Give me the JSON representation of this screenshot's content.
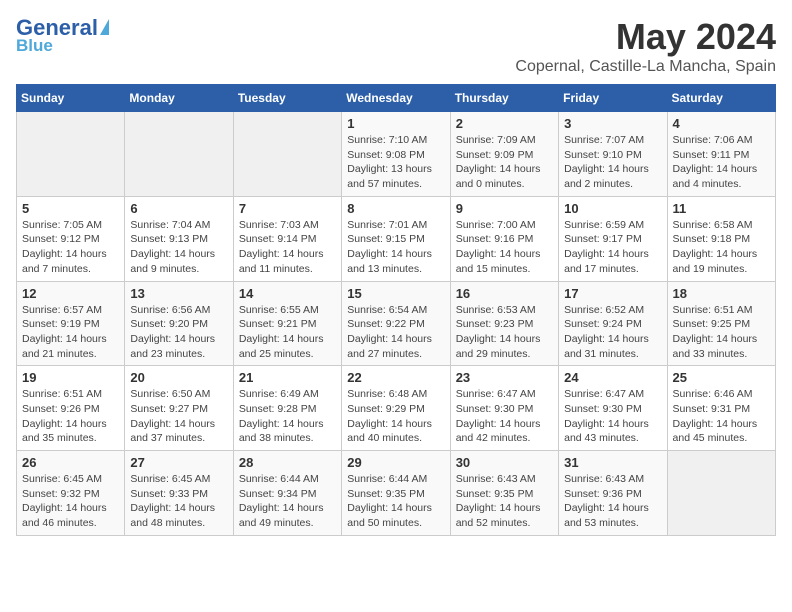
{
  "header": {
    "logo_general": "General",
    "logo_blue": "Blue",
    "title": "May 2024",
    "subtitle": "Copernal, Castille-La Mancha, Spain"
  },
  "days_of_week": [
    "Sunday",
    "Monday",
    "Tuesday",
    "Wednesday",
    "Thursday",
    "Friday",
    "Saturday"
  ],
  "weeks": [
    [
      {
        "day": "",
        "info": ""
      },
      {
        "day": "",
        "info": ""
      },
      {
        "day": "",
        "info": ""
      },
      {
        "day": "1",
        "info": "Sunrise: 7:10 AM\nSunset: 9:08 PM\nDaylight: 13 hours and 57 minutes."
      },
      {
        "day": "2",
        "info": "Sunrise: 7:09 AM\nSunset: 9:09 PM\nDaylight: 14 hours and 0 minutes."
      },
      {
        "day": "3",
        "info": "Sunrise: 7:07 AM\nSunset: 9:10 PM\nDaylight: 14 hours and 2 minutes."
      },
      {
        "day": "4",
        "info": "Sunrise: 7:06 AM\nSunset: 9:11 PM\nDaylight: 14 hours and 4 minutes."
      }
    ],
    [
      {
        "day": "5",
        "info": "Sunrise: 7:05 AM\nSunset: 9:12 PM\nDaylight: 14 hours and 7 minutes."
      },
      {
        "day": "6",
        "info": "Sunrise: 7:04 AM\nSunset: 9:13 PM\nDaylight: 14 hours and 9 minutes."
      },
      {
        "day": "7",
        "info": "Sunrise: 7:03 AM\nSunset: 9:14 PM\nDaylight: 14 hours and 11 minutes."
      },
      {
        "day": "8",
        "info": "Sunrise: 7:01 AM\nSunset: 9:15 PM\nDaylight: 14 hours and 13 minutes."
      },
      {
        "day": "9",
        "info": "Sunrise: 7:00 AM\nSunset: 9:16 PM\nDaylight: 14 hours and 15 minutes."
      },
      {
        "day": "10",
        "info": "Sunrise: 6:59 AM\nSunset: 9:17 PM\nDaylight: 14 hours and 17 minutes."
      },
      {
        "day": "11",
        "info": "Sunrise: 6:58 AM\nSunset: 9:18 PM\nDaylight: 14 hours and 19 minutes."
      }
    ],
    [
      {
        "day": "12",
        "info": "Sunrise: 6:57 AM\nSunset: 9:19 PM\nDaylight: 14 hours and 21 minutes."
      },
      {
        "day": "13",
        "info": "Sunrise: 6:56 AM\nSunset: 9:20 PM\nDaylight: 14 hours and 23 minutes."
      },
      {
        "day": "14",
        "info": "Sunrise: 6:55 AM\nSunset: 9:21 PM\nDaylight: 14 hours and 25 minutes."
      },
      {
        "day": "15",
        "info": "Sunrise: 6:54 AM\nSunset: 9:22 PM\nDaylight: 14 hours and 27 minutes."
      },
      {
        "day": "16",
        "info": "Sunrise: 6:53 AM\nSunset: 9:23 PM\nDaylight: 14 hours and 29 minutes."
      },
      {
        "day": "17",
        "info": "Sunrise: 6:52 AM\nSunset: 9:24 PM\nDaylight: 14 hours and 31 minutes."
      },
      {
        "day": "18",
        "info": "Sunrise: 6:51 AM\nSunset: 9:25 PM\nDaylight: 14 hours and 33 minutes."
      }
    ],
    [
      {
        "day": "19",
        "info": "Sunrise: 6:51 AM\nSunset: 9:26 PM\nDaylight: 14 hours and 35 minutes."
      },
      {
        "day": "20",
        "info": "Sunrise: 6:50 AM\nSunset: 9:27 PM\nDaylight: 14 hours and 37 minutes."
      },
      {
        "day": "21",
        "info": "Sunrise: 6:49 AM\nSunset: 9:28 PM\nDaylight: 14 hours and 38 minutes."
      },
      {
        "day": "22",
        "info": "Sunrise: 6:48 AM\nSunset: 9:29 PM\nDaylight: 14 hours and 40 minutes."
      },
      {
        "day": "23",
        "info": "Sunrise: 6:47 AM\nSunset: 9:30 PM\nDaylight: 14 hours and 42 minutes."
      },
      {
        "day": "24",
        "info": "Sunrise: 6:47 AM\nSunset: 9:30 PM\nDaylight: 14 hours and 43 minutes."
      },
      {
        "day": "25",
        "info": "Sunrise: 6:46 AM\nSunset: 9:31 PM\nDaylight: 14 hours and 45 minutes."
      }
    ],
    [
      {
        "day": "26",
        "info": "Sunrise: 6:45 AM\nSunset: 9:32 PM\nDaylight: 14 hours and 46 minutes."
      },
      {
        "day": "27",
        "info": "Sunrise: 6:45 AM\nSunset: 9:33 PM\nDaylight: 14 hours and 48 minutes."
      },
      {
        "day": "28",
        "info": "Sunrise: 6:44 AM\nSunset: 9:34 PM\nDaylight: 14 hours and 49 minutes."
      },
      {
        "day": "29",
        "info": "Sunrise: 6:44 AM\nSunset: 9:35 PM\nDaylight: 14 hours and 50 minutes."
      },
      {
        "day": "30",
        "info": "Sunrise: 6:43 AM\nSunset: 9:35 PM\nDaylight: 14 hours and 52 minutes."
      },
      {
        "day": "31",
        "info": "Sunrise: 6:43 AM\nSunset: 9:36 PM\nDaylight: 14 hours and 53 minutes."
      },
      {
        "day": "",
        "info": ""
      }
    ]
  ]
}
